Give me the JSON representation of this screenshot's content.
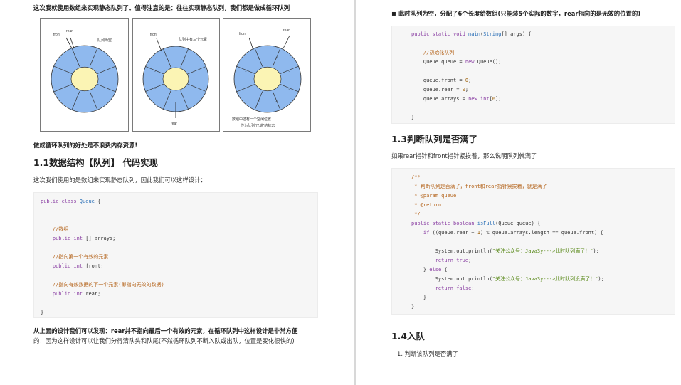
{
  "left": {
    "intro": "这次我就使用数组来实现静态队列了。值得注意的是：往往实现静态队列，我们都是做成循环队列",
    "figures": [
      {
        "labels": [
          "front",
          "rear",
          "队列为空"
        ]
      },
      {
        "labels": [
          "front",
          "队列中有三个元素",
          "rear"
        ]
      },
      {
        "labels": [
          "front",
          "rear",
          "数组中还有一个空闲位置",
          "作为队列“已满”的标志"
        ]
      }
    ],
    "benefit": "做成循环队列的好处是不浪费内存资源!",
    "heading_11": "1.1数据结构【队列】 代码实现",
    "design_text": "这次我们使用的是数组来实现静态队列，因此我们可以这样设计：",
    "code1": [
      "public class Queue {",
      "",
      "",
      "    //数组",
      "    public int [] arrays;",
      "",
      "    //指向第一个有效的元素",
      "    public int front;",
      "",
      "    //指向有效数据的下一个元素(即指向无效的数据)",
      "    public int rear;",
      "",
      "}"
    ],
    "conclusion_1": "从上面的设计我们可以发现：rear并不指向最后一个有效的元素，在循环队列中这样设计是非常方便",
    "conclusion_2": "的！因为这样设计可以让我们分得清队头和队尾(不然循环队列不断入队或出队，位置是变化很快的)"
  },
  "right": {
    "top_note": "此时队列为空，分配了6个长度给数组(只能装5个实际的数字，rear指向的是无效的位置的)",
    "code2": [
      "public static void main(String[] args) {",
      "",
      "    //初始化队列",
      "    Queue queue = new Queue();",
      "",
      "    queue.front = 0;",
      "    queue.rear = 0;",
      "    queue.arrays = new int[6];",
      "",
      "}"
    ],
    "heading_13": "1.3判断队列是否满了",
    "full_text": "如果rear指针和front指针紧挨着，那么说明队列就满了",
    "code3": [
      "/**",
      " * 判断队列是否满了，front和rear指针紧挨着，就是满了",
      " * @param queue",
      " * @return",
      " */",
      "public static boolean isFull(Queue queue) {",
      "    if ((queue.rear + 1) % queue.arrays.length == queue.front) {",
      "",
      "        System.out.println(\"关注公众号：Java3y--->此时队列满了！\");",
      "        return true;",
      "    } else {",
      "        System.out.println(\"关注公众号：Java3y--->此时队列没满了！\");",
      "        return false;",
      "    }",
      "}"
    ],
    "heading_14": "1.4入队",
    "step_1": "1.  判断该队列是否满了"
  },
  "colors": {
    "sector": "#8fb9ee",
    "hub": "#fbf4b4",
    "keyword": "#8a3fa3",
    "comment": "#b5651d"
  }
}
